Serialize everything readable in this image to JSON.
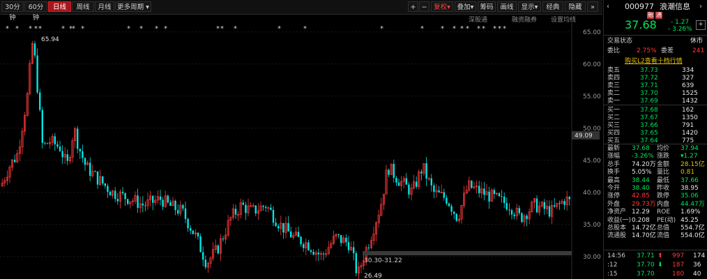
{
  "toolbar": {
    "periods": [
      "30分钟",
      "60分钟",
      "日线",
      "周线",
      "月线",
      "更多周期"
    ],
    "active_period": "日线",
    "right_buttons": [
      "复权",
      "叠加",
      "筹码",
      "画线",
      "显示",
      "经典",
      "隐藏"
    ],
    "zoom_in": "+",
    "zoom_out": "−",
    "sub_links": [
      "深股通",
      "融资融券",
      "设置均线"
    ]
  },
  "chart": {
    "y_labels": [
      "65.00",
      "60.00",
      "55.00",
      "50.00",
      "45.00",
      "40.00",
      "35.00",
      "30.00"
    ],
    "current_price_tag": "49.09",
    "high_label": "65.94",
    "low_label": "26.49",
    "range_label": "30.30-31.22",
    "star_symbol": "*",
    "arrow_symbol": "⬆"
  },
  "quote": {
    "code": "000977",
    "name": "浪潮信息",
    "badges": [
      "融",
      "通"
    ],
    "price": "37.68",
    "change": "- 1.27",
    "change_pct": "- 3.26%",
    "add_btn": "+",
    "status_label": "交易状态",
    "status_value": "休市",
    "ratio_label": "委比",
    "ratio_value": "2.75%",
    "diff_label": "委差",
    "diff_value": "241",
    "l2_link": "购买L2查看十档行情",
    "asks": [
      {
        "label": "卖五",
        "price": "37.73",
        "vol": "334"
      },
      {
        "label": "卖四",
        "price": "37.72",
        "vol": "327"
      },
      {
        "label": "卖三",
        "price": "37.71",
        "vol": "639"
      },
      {
        "label": "卖二",
        "price": "37.70",
        "vol": "1525"
      },
      {
        "label": "卖一",
        "price": "37.69",
        "vol": "1432"
      }
    ],
    "bids": [
      {
        "label": "买一",
        "price": "37.68",
        "vol": "162"
      },
      {
        "label": "买二",
        "price": "37.67",
        "vol": "1350"
      },
      {
        "label": "买三",
        "price": "37.66",
        "vol": "791"
      },
      {
        "label": "买四",
        "price": "37.65",
        "vol": "1420"
      },
      {
        "label": "买五",
        "price": "37.64",
        "vol": "775"
      }
    ],
    "stats": [
      {
        "l1": "最新",
        "v1": "37.68",
        "c1": "g",
        "l2": "均价",
        "v2": "37.94",
        "c2": "g"
      },
      {
        "l1": "涨幅",
        "v1": "-3.26%",
        "c1": "g",
        "l2": "涨跌",
        "v2": "▾1.27",
        "c2": "g"
      },
      {
        "l1": "总手",
        "v1": "74.20万",
        "c1": "w",
        "l2": "金额",
        "v2": "28.15亿",
        "c2": "y"
      },
      {
        "l1": "换手",
        "v1": "5.05%",
        "c1": "w",
        "l2": "量比",
        "v2": "0.81",
        "c2": "y"
      },
      {
        "l1": "最高",
        "v1": "38.44",
        "c1": "g",
        "l2": "最低",
        "v2": "37.66",
        "c2": "g"
      },
      {
        "l1": "今开",
        "v1": "38.40",
        "c1": "g",
        "l2": "昨收",
        "v2": "38.95",
        "c2": "w"
      },
      {
        "l1": "涨停",
        "v1": "42.85",
        "c1": "r",
        "l2": "跌停",
        "v2": "35.06",
        "c2": "g"
      },
      {
        "l1": "外盘",
        "v1": "29.73万",
        "c1": "r",
        "l2": "内盘",
        "v2": "44.47万",
        "c2": "g"
      },
      {
        "l1": "净资产",
        "v1": "12.29",
        "c1": "w",
        "l2": "ROE",
        "v2": "1.69%",
        "c2": "w"
      },
      {
        "l1": "收益(一)",
        "v1": "0.208",
        "c1": "w",
        "l2": "PE(动)",
        "v2": "45.25",
        "c2": "w"
      },
      {
        "l1": "总股本",
        "v1": "14.72亿",
        "c1": "w",
        "l2": "总值",
        "v2": "554.7亿",
        "c2": "w"
      },
      {
        "l1": "流通股",
        "v1": "14.70亿",
        "c1": "w",
        "l2": "流值",
        "v2": "554.0亿",
        "c2": "w"
      }
    ],
    "ticks": [
      {
        "time": "14:56",
        "price": "37.71",
        "arrow": "⬆",
        "vol": "997",
        "num": "174"
      },
      {
        "time": ":12",
        "price": "37.70",
        "arrow": "⬇",
        "vol": "187",
        "num": "36"
      },
      {
        "time": ":15",
        "price": "37.70",
        "arrow": "",
        "vol": "180",
        "num": "40"
      }
    ]
  },
  "colors": {
    "up": "#ff3b3b",
    "down": "#00e6e6",
    "bg": "#000000",
    "accent": "#a8141a"
  }
}
